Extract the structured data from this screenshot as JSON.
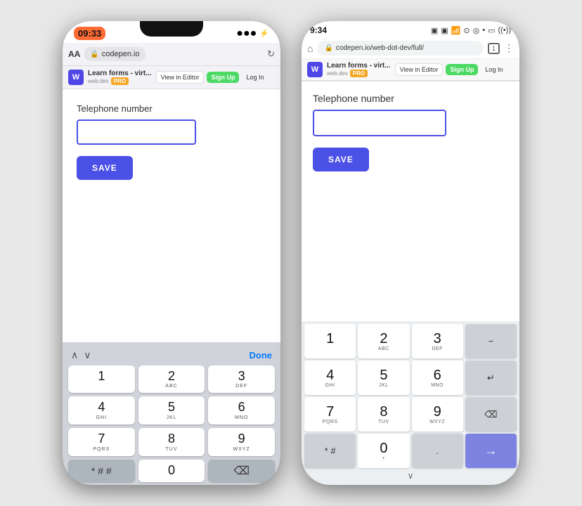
{
  "left_phone": {
    "status_bar": {
      "time": "09:33",
      "battery": "⚡"
    },
    "browser": {
      "aa": "AA",
      "lock": "🔒",
      "url": "codepen.io",
      "refresh": "↻"
    },
    "toolbar": {
      "logo": "W",
      "title": "Learn forms - virt...",
      "domain": "web.dev",
      "pro": "PRO",
      "view_editor": "View in Editor",
      "signup": "Sign Up",
      "login": "Log In"
    },
    "form": {
      "label": "Telephone number",
      "save_btn": "SAVE"
    },
    "keyboard": {
      "done": "Done",
      "keys": [
        {
          "num": "1",
          "letters": ""
        },
        {
          "num": "2",
          "letters": "ABC"
        },
        {
          "num": "3",
          "letters": "DEF"
        },
        {
          "num": "4",
          "letters": "GHI"
        },
        {
          "num": "5",
          "letters": "JKL"
        },
        {
          "num": "6",
          "letters": "MNO"
        },
        {
          "num": "7",
          "letters": "PQRS"
        },
        {
          "num": "8",
          "letters": "TUV"
        },
        {
          "num": "9",
          "letters": "WXYZ"
        },
        {
          "num": "* # #",
          "letters": ""
        },
        {
          "num": "0",
          "letters": ""
        },
        {
          "num": "⌫",
          "letters": ""
        }
      ]
    }
  },
  "right_phone": {
    "status_bar": {
      "time": "9:34",
      "icons": [
        "SIM",
        "📶",
        "🔋"
      ]
    },
    "browser": {
      "home": "⌂",
      "lock": "🔒",
      "url": "codepen.io/web-dot-dev/full/",
      "tab": "1",
      "menu": "⋮"
    },
    "toolbar": {
      "logo": "W",
      "title": "Learn forms - virt...",
      "domain": "web.dev",
      "pro": "PRO",
      "view_editor": "View in Editor",
      "signup": "Sign Up",
      "login": "Log In"
    },
    "form": {
      "label": "Telephone number",
      "save_btn": "SAVE"
    },
    "keyboard": {
      "keys": [
        {
          "num": "1",
          "letters": "",
          "type": "normal"
        },
        {
          "num": "2",
          "letters": "ABC",
          "type": "normal"
        },
        {
          "num": "3",
          "letters": "DEF",
          "type": "normal"
        },
        {
          "num": "−",
          "letters": "",
          "type": "dark"
        },
        {
          "num": "4",
          "letters": "GHI",
          "type": "normal"
        },
        {
          "num": "5",
          "letters": "JKL",
          "type": "normal"
        },
        {
          "num": "6",
          "letters": "MNO",
          "type": "normal"
        },
        {
          "num": "↵",
          "letters": "",
          "type": "dark"
        },
        {
          "num": "7",
          "letters": "PQRS",
          "type": "normal"
        },
        {
          "num": "8",
          "letters": "TUV",
          "type": "normal"
        },
        {
          "num": "9",
          "letters": "WXYZ",
          "type": "normal"
        },
        {
          "num": "⌫",
          "letters": "",
          "type": "dark"
        },
        {
          "num": "* #",
          "letters": "",
          "type": "dark"
        },
        {
          "num": "0",
          "letters": "+",
          "type": "normal"
        },
        {
          "num": ".",
          "letters": "",
          "type": "dark"
        },
        {
          "num": "→",
          "letters": "",
          "type": "blue"
        }
      ],
      "chevron": "∨"
    }
  }
}
